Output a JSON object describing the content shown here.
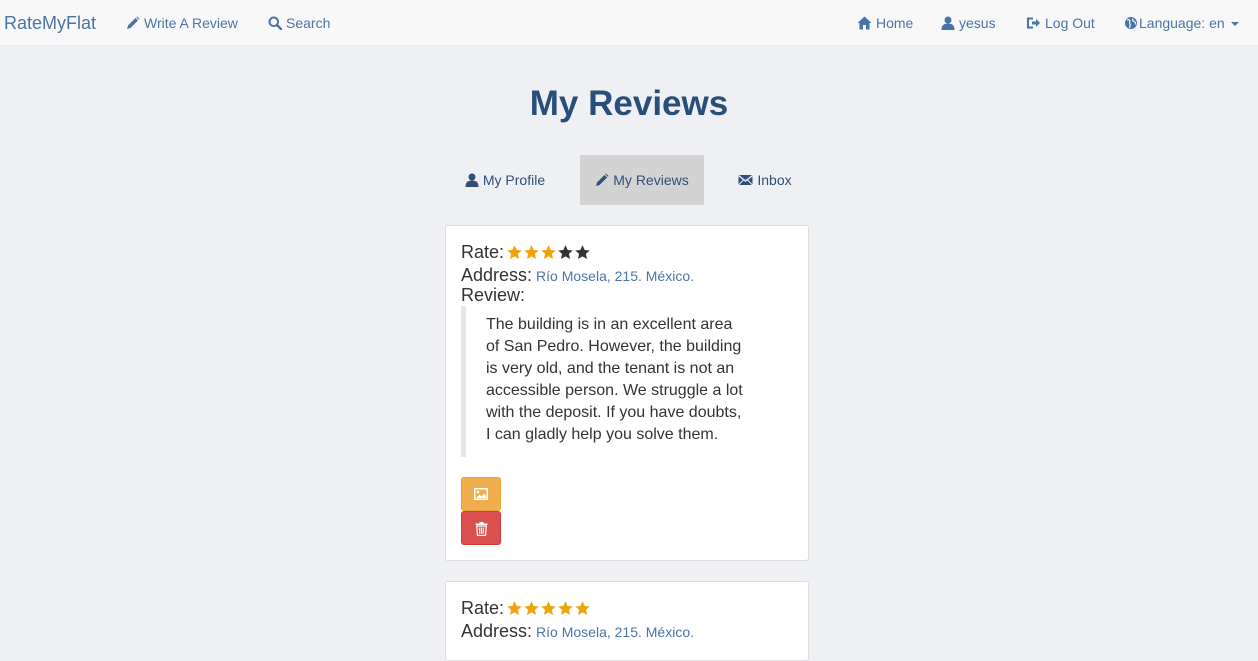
{
  "navbar": {
    "brand": "RateMyFlat",
    "write_review": "Write A Review",
    "search": "Search",
    "home": "Home",
    "user": "yesus",
    "logout": "Log Out",
    "language": "Language: en"
  },
  "page": {
    "title": "My Reviews"
  },
  "tabs": [
    {
      "label": "My Profile",
      "icon": "user-icon"
    },
    {
      "label": "My Reviews",
      "icon": "pencil-icon",
      "active": true
    },
    {
      "label": "Inbox",
      "icon": "envelope-icon"
    }
  ],
  "reviews": [
    {
      "rate_label": "Rate:",
      "rating": 3,
      "max_rating": 5,
      "address_label": "Address:",
      "address": "Río Mosela, 215. México.",
      "review_label": "Review:",
      "text": "The building is in an excellent area of San Pedro. However, the building is very old, and the tenant is not an accessible person. We struggle a lot with the deposit. If you have doubts, I can gladly help you solve them."
    },
    {
      "rate_label": "Rate:",
      "rating": 5,
      "max_rating": 5,
      "address_label": "Address:",
      "address": "Río Mosela, 215. México."
    }
  ],
  "colors": {
    "link": "#4a74a8",
    "title": "#284e79",
    "star_filled": "#f0a30a",
    "star_empty": "#333333",
    "warning": "#efad4d",
    "danger": "#d9504e"
  }
}
